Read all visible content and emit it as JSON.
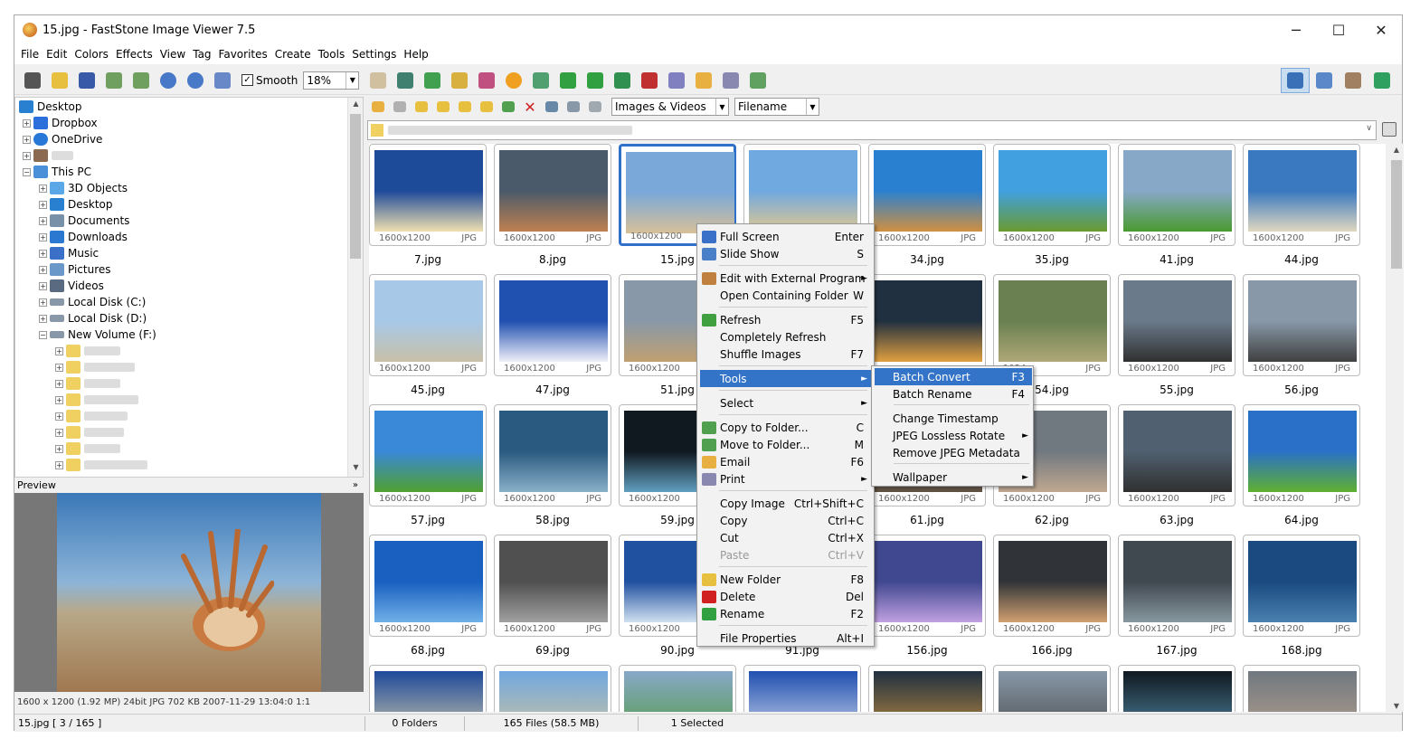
{
  "window": {
    "title": "15.jpg  -  FastStone Image Viewer 7.5",
    "minimize": "─",
    "maximize": "☐",
    "close": "✕"
  },
  "menu": [
    "File",
    "Edit",
    "Colors",
    "Effects",
    "View",
    "Tag",
    "Favorites",
    "Create",
    "Tools",
    "Settings",
    "Help"
  ],
  "toolbar": {
    "smooth_label": "Smooth",
    "smooth_checked": "✓",
    "zoom_value": "18%",
    "filter_value": "Images & Videos",
    "sort_value": "Filename"
  },
  "tree": [
    {
      "label": "Desktop",
      "level": 0
    },
    {
      "label": "Dropbox",
      "level": 1
    },
    {
      "label": "OneDrive",
      "level": 1
    },
    {
      "label": "",
      "level": 1
    },
    {
      "label": "This PC",
      "level": 1
    },
    {
      "label": "3D Objects",
      "level": 2
    },
    {
      "label": "Desktop",
      "level": 2
    },
    {
      "label": "Documents",
      "level": 2
    },
    {
      "label": "Downloads",
      "level": 2
    },
    {
      "label": "Music",
      "level": 2
    },
    {
      "label": "Pictures",
      "level": 2
    },
    {
      "label": "Videos",
      "level": 2
    },
    {
      "label": "Local Disk (C:)",
      "level": 2
    },
    {
      "label": "Local Disk (D:)",
      "level": 2
    },
    {
      "label": "New Volume (F:)",
      "level": 2
    }
  ],
  "preview": {
    "header": "Preview",
    "info": "1600 x 1200 (1.92 MP)  24bit  JPG   702 KB   2007-11-29 13:04:0  1:1"
  },
  "status": {
    "file": "15.jpg [ 3 / 165 ]",
    "folders": "0 Folders",
    "files": "165 Files (58.5 MB)",
    "selected": "1 Selected"
  },
  "thumbs": [
    {
      "name": "7.jpg",
      "res": "1600x1200",
      "ext": "JPG"
    },
    {
      "name": "8.jpg",
      "res": "1600x1200",
      "ext": "JPG"
    },
    {
      "name": "15.jpg",
      "res": "1600x1200",
      "ext": "JPG"
    },
    {
      "name": "",
      "res": "",
      "ext": ""
    },
    {
      "name": "34.jpg",
      "res": "1600x1200",
      "ext": "JPG"
    },
    {
      "name": "35.jpg",
      "res": "1600x1200",
      "ext": "JPG"
    },
    {
      "name": "41.jpg",
      "res": "1600x1200",
      "ext": "JPG"
    },
    {
      "name": "44.jpg",
      "res": "1600x1200",
      "ext": "JPG"
    },
    {
      "name": "45.jpg",
      "res": "1600x1200",
      "ext": "JPG"
    },
    {
      "name": "47.jpg",
      "res": "1600x1200",
      "ext": "JPG"
    },
    {
      "name": "51.jpg",
      "res": "1600x1200",
      "ext": "JPG"
    },
    {
      "name": "",
      "res": "",
      "ext": ""
    },
    {
      "name": "",
      "res": "",
      "ext": ""
    },
    {
      "name": "54.jpg",
      "res": "1024",
      "ext": "JPG"
    },
    {
      "name": "55.jpg",
      "res": "1600x1200",
      "ext": "JPG"
    },
    {
      "name": "56.jpg",
      "res": "1600x1200",
      "ext": "JPG"
    },
    {
      "name": "57.jpg",
      "res": "1600x1200",
      "ext": "JPG"
    },
    {
      "name": "58.jpg",
      "res": "1600x1200",
      "ext": "JPG"
    },
    {
      "name": "59.jpg",
      "res": "1600x1200",
      "ext": "JPG"
    },
    {
      "name": "",
      "res": "",
      "ext": ""
    },
    {
      "name": "61.jpg",
      "res": "1600x1200",
      "ext": "JPG"
    },
    {
      "name": "62.jpg",
      "res": "1600x1200",
      "ext": "JPG"
    },
    {
      "name": "63.jpg",
      "res": "1600x1200",
      "ext": "JPG"
    },
    {
      "name": "64.jpg",
      "res": "1600x1200",
      "ext": "JPG"
    },
    {
      "name": "68.jpg",
      "res": "1600x1200",
      "ext": "JPG"
    },
    {
      "name": "69.jpg",
      "res": "1600x1200",
      "ext": "JPG"
    },
    {
      "name": "90.jpg",
      "res": "1600x1200",
      "ext": "JPG"
    },
    {
      "name": "91.jpg",
      "res": "",
      "ext": ""
    },
    {
      "name": "156.jpg",
      "res": "1600x1200",
      "ext": "JPG"
    },
    {
      "name": "166.jpg",
      "res": "1600x1200",
      "ext": "JPG"
    },
    {
      "name": "167.jpg",
      "res": "1600x1200",
      "ext": "JPG"
    },
    {
      "name": "168.jpg",
      "res": "1600x1200",
      "ext": "JPG"
    }
  ],
  "thumb_colors": [
    [
      "#1e4a9a",
      "#f0e0b0"
    ],
    [
      "#4a5a6a",
      "#c08050"
    ],
    [
      "#7aa8d8",
      "#d8c098"
    ],
    [
      "#70a8e0",
      "#e0c890"
    ],
    [
      "#2a80d0",
      "#d09040"
    ],
    [
      "#40a0e0",
      "#6a9a30"
    ],
    [
      "#88a8c8",
      "#4a9a30"
    ],
    [
      "#3a78c0",
      "#e0d8c0"
    ],
    [
      "#a8c8e8",
      "#c8c0a8"
    ],
    [
      "#2050b0",
      "#f0f0f8"
    ],
    [
      "#8898a8",
      "#c0a070"
    ],
    [
      "#f0a020",
      "#303030"
    ],
    [
      "#203040",
      "#e0a040"
    ],
    [
      "#6a8050",
      "#b0a878"
    ],
    [
      "#6a7a8a",
      "#303030"
    ],
    [
      "#8898a8",
      "#404040"
    ],
    [
      "#3a88d8",
      "#50a030"
    ],
    [
      "#2a5a80",
      "#8ab0c8"
    ],
    [
      "#101820",
      "#60a0c0"
    ],
    [
      "#c09060",
      "#404040"
    ],
    [
      "#8898a8",
      "#605040"
    ],
    [
      "#707880",
      "#c0a890"
    ],
    [
      "#506070",
      "#303030"
    ],
    [
      "#2a70c8",
      "#60b030"
    ],
    [
      "#1a60c0",
      "#70b0e8"
    ],
    [
      "#505050",
      "#a0a0a0"
    ],
    [
      "#2050a0",
      "#d0e0f0"
    ],
    [
      "#70a0c0",
      "#a0a080"
    ],
    [
      "#404890",
      "#c0a0e0"
    ],
    [
      "#303438",
      "#d0a070"
    ],
    [
      "#404850",
      "#8898a0"
    ],
    [
      "#1a4a80",
      "#4a80b0"
    ]
  ],
  "context_menu": [
    {
      "label": "Full Screen",
      "shortcut": "Enter"
    },
    {
      "label": "Slide Show",
      "shortcut": "S"
    },
    {
      "label": "Edit with External Program",
      "shortcut": "",
      "submenu": "►"
    },
    {
      "label": "Open Containing Folder",
      "shortcut": "W"
    },
    {
      "label": "Refresh",
      "shortcut": "F5"
    },
    {
      "label": "Completely Refresh",
      "shortcut": ""
    },
    {
      "label": "Shuffle Images",
      "shortcut": "F7"
    },
    {
      "label": "Tools",
      "shortcut": "",
      "submenu": "►"
    },
    {
      "label": "Select",
      "shortcut": "",
      "submenu": "►"
    },
    {
      "label": "Copy to Folder...",
      "shortcut": "C"
    },
    {
      "label": "Move to Folder...",
      "shortcut": "M"
    },
    {
      "label": "Email",
      "shortcut": "F6"
    },
    {
      "label": "Print",
      "shortcut": "",
      "submenu": "►"
    },
    {
      "label": "Copy Image",
      "shortcut": "Ctrl+Shift+C"
    },
    {
      "label": "Copy",
      "shortcut": "Ctrl+C"
    },
    {
      "label": "Cut",
      "shortcut": "Ctrl+X"
    },
    {
      "label": "Paste",
      "shortcut": "Ctrl+V"
    },
    {
      "label": "New Folder",
      "shortcut": "F8"
    },
    {
      "label": "Delete",
      "shortcut": "Del"
    },
    {
      "label": "Rename",
      "shortcut": "F2"
    },
    {
      "label": "File Properties",
      "shortcut": "Alt+I"
    }
  ],
  "tools_submenu": [
    {
      "label": "Batch Convert",
      "shortcut": "F3"
    },
    {
      "label": "Batch Rename",
      "shortcut": "F4"
    },
    {
      "label": "Change Timestamp",
      "shortcut": ""
    },
    {
      "label": "JPEG Lossless Rotate",
      "shortcut": "",
      "submenu": "►"
    },
    {
      "label": "Remove JPEG Metadata",
      "shortcut": ""
    },
    {
      "label": "Wallpaper",
      "shortcut": "",
      "submenu": "►"
    }
  ]
}
